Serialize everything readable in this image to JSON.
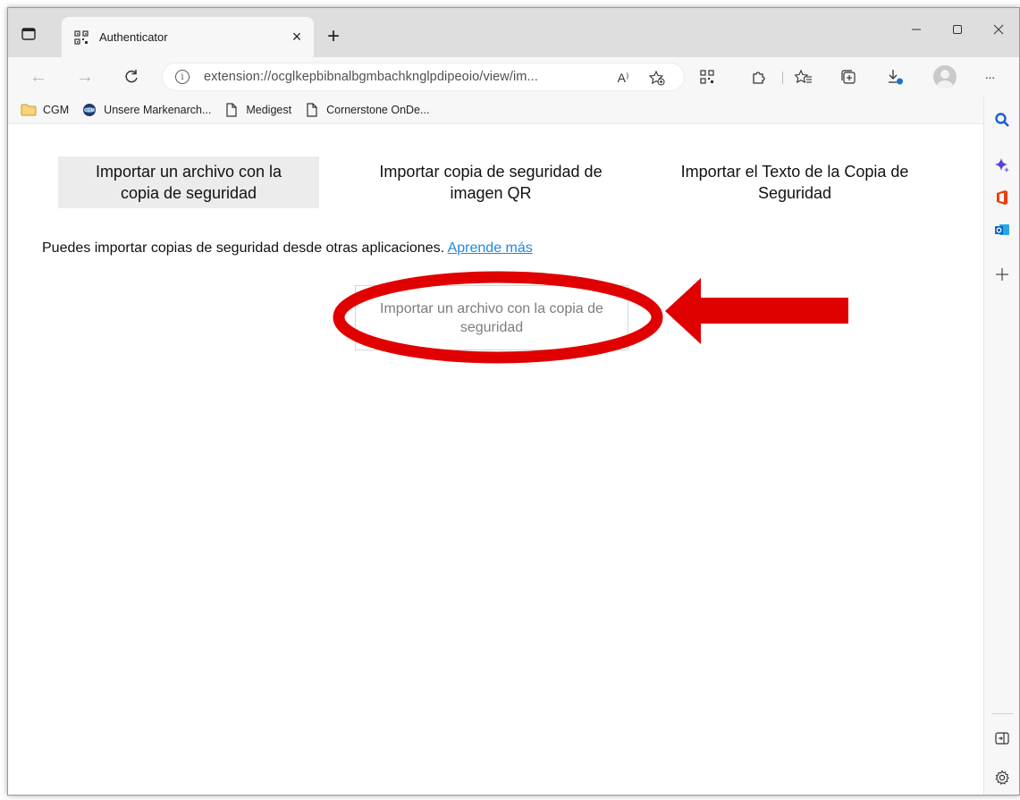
{
  "window": {
    "tab_title": "Authenticator",
    "tab_close": "×",
    "new_tab": "+",
    "controls": {
      "minimize": "—",
      "maximize": "▢",
      "close": "✕"
    }
  },
  "toolbar": {
    "back": "←",
    "forward": "→",
    "reload": "C",
    "url": "extension://ocglkepbibnalbgmbachknglpdipeoio/view/im...",
    "read_aloud": "A⁾",
    "more": "···"
  },
  "bookmarks": [
    {
      "label": "CGM",
      "icon": "folder-icon"
    },
    {
      "label": "Unsere Markenarch...",
      "icon": "globe-icon"
    },
    {
      "label": "Medigest",
      "icon": "page-icon"
    },
    {
      "label": "Cornerstone OnDe...",
      "icon": "page-icon"
    }
  ],
  "content": {
    "tabs": [
      {
        "label": "Importar un archivo con la copia de seguridad",
        "selected": true
      },
      {
        "label": "Importar copia de seguridad de imagen QR",
        "selected": false
      },
      {
        "label": "Importar el Texto de la Copia de Seguridad",
        "selected": false
      }
    ],
    "hint_text": "Puedes importar copias de seguridad desde otras aplicaciones.",
    "hint_link": "Aprende más",
    "import_button": "Importar un archivo con la copia de seguridad"
  },
  "sidebar": {
    "icons": [
      "search-icon",
      "copilot-icon",
      "office-icon",
      "outlook-icon",
      "add-icon",
      "split-screen-icon",
      "settings-icon"
    ]
  },
  "annotation": {
    "highlight_color": "#e00000"
  }
}
